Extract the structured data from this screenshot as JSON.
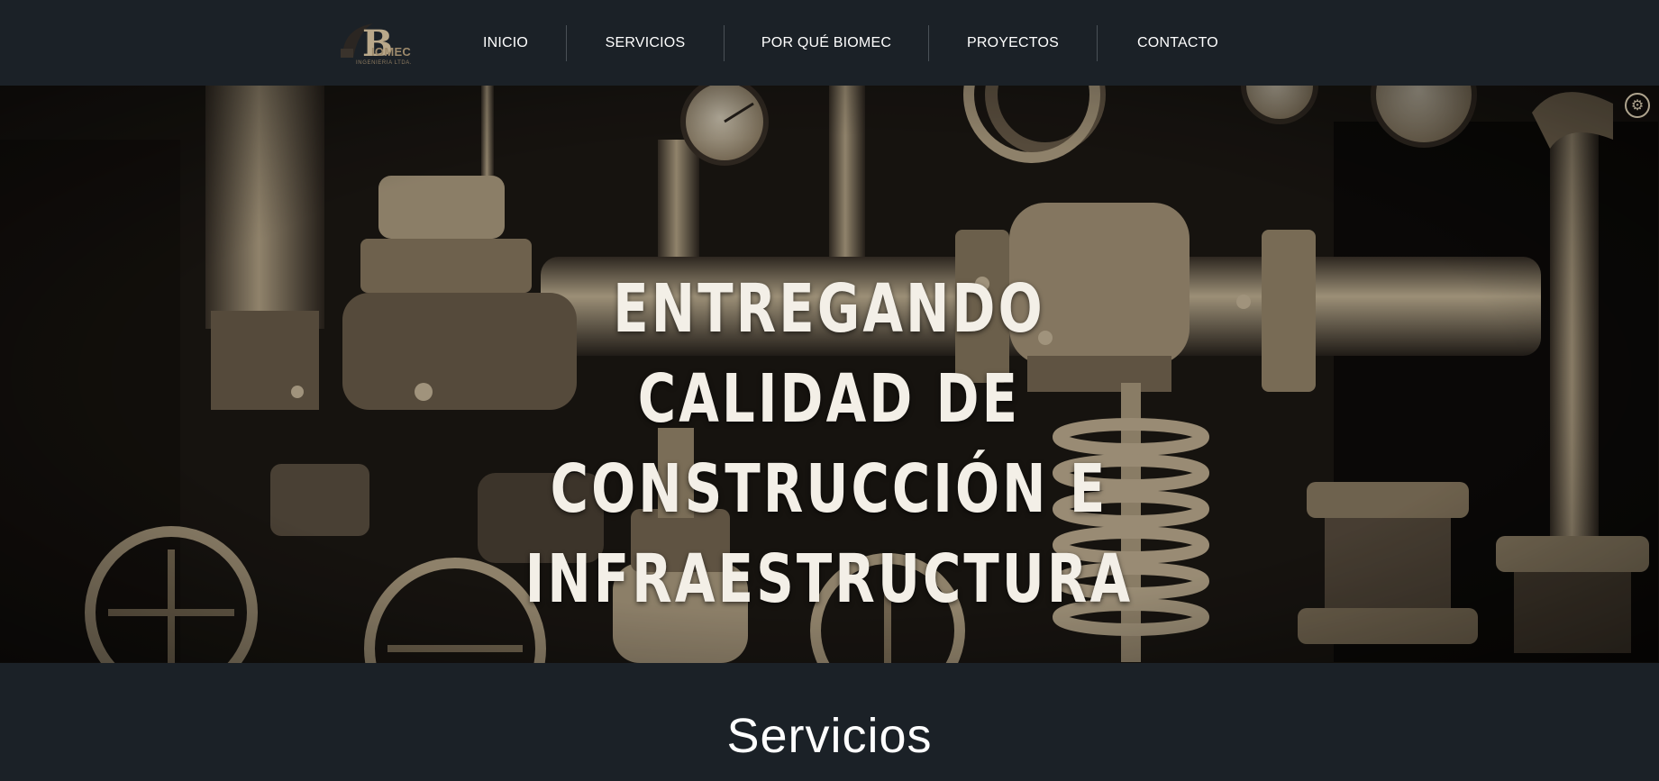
{
  "header": {
    "logo": {
      "letter": "B",
      "text": "IOMEC",
      "subtitle": "INGENIERIA LTDA."
    },
    "nav": [
      {
        "label": "INICIO"
      },
      {
        "label": "SERVICIOS"
      },
      {
        "label": "POR QUÉ BIOMEC"
      },
      {
        "label": "PROYECTOS"
      },
      {
        "label": "CONTACTO"
      }
    ]
  },
  "hero": {
    "title_lines": [
      "ENTREGANDO CALIDAD DE",
      "CONSTRUCCIÓN E",
      "INFRAESTRUCTURA"
    ],
    "background_description_icon": "industrial-pipes-valves-image",
    "corner_icon": "gear-icon"
  },
  "services": {
    "title": "Servicios"
  },
  "colors": {
    "header_bg": "#1b2127",
    "hero_text": "#f3efe7",
    "accent_sepia": "#b9a88a"
  }
}
